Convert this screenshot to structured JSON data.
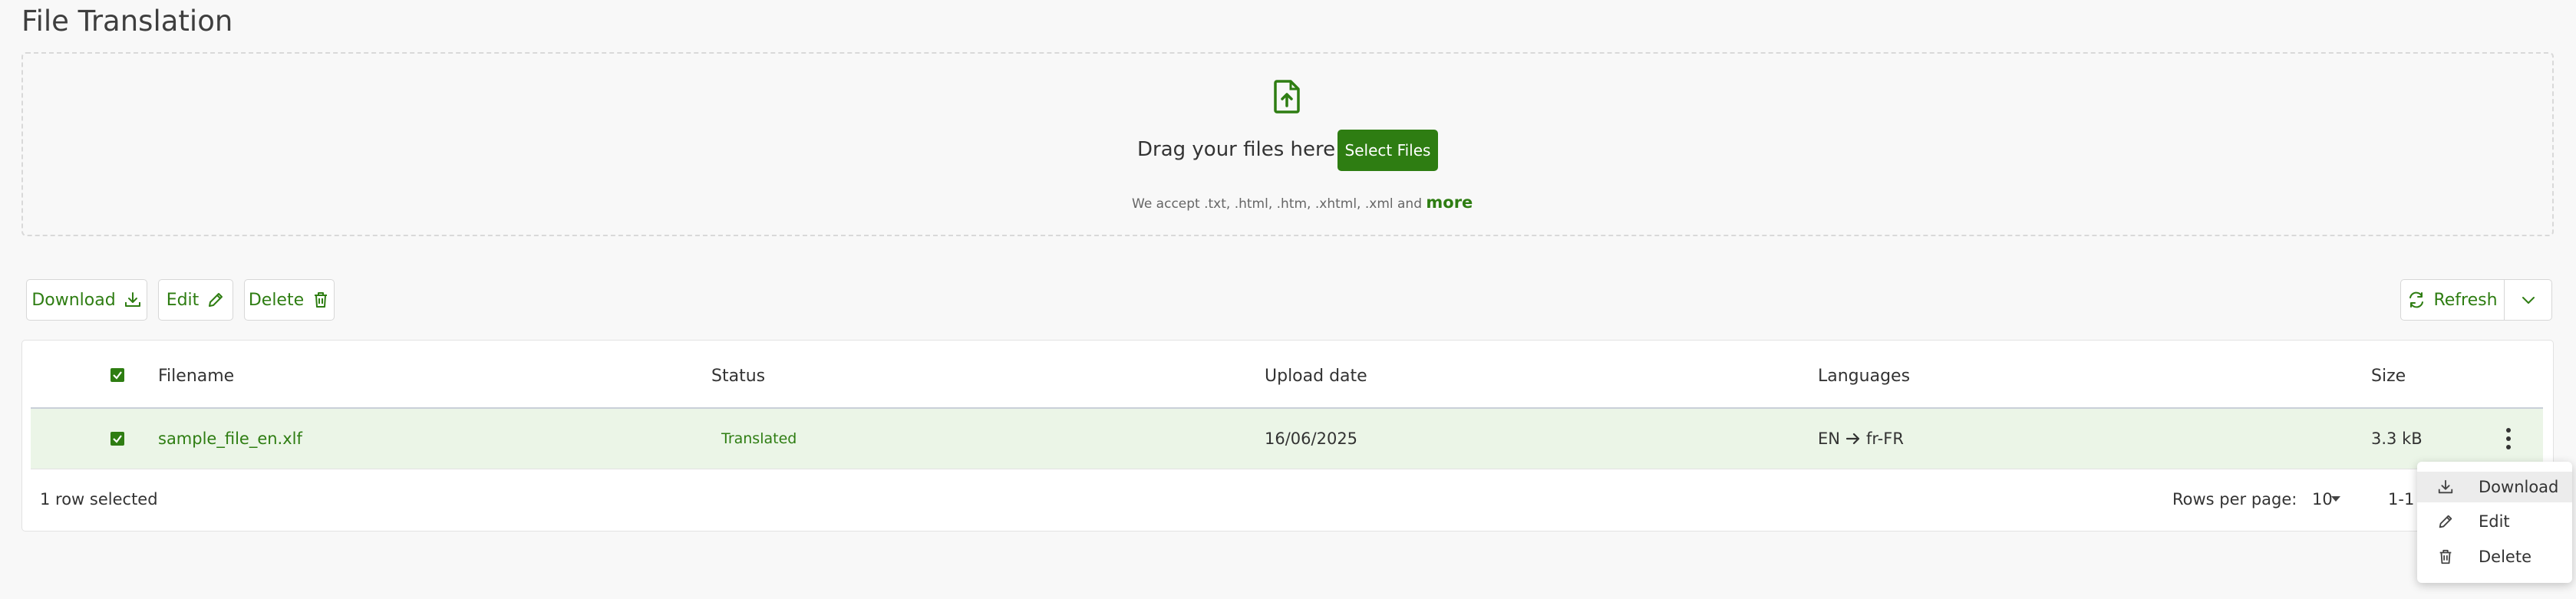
{
  "page_title": "File Translation",
  "upload": {
    "icon": "file-upload-icon",
    "drag_text": "Drag your files here or",
    "select_button": "Select Files",
    "accept_text": "We accept .txt, .html, .htm, .xhtml, .xml and",
    "more_link": "more"
  },
  "toolbar": {
    "download_label": "Download",
    "edit_label": "Edit",
    "delete_label": "Delete",
    "refresh_label": "Refresh"
  },
  "table": {
    "columns": [
      "Filename",
      "Status",
      "Upload date",
      "Languages",
      "Size"
    ],
    "rows": [
      {
        "selected": true,
        "filename": "sample_file_en.xlf",
        "status": "Translated",
        "upload_date": "16/06/2025",
        "source_lang": "EN",
        "target_lang": "fr-FR",
        "size": "3.3 kB"
      }
    ],
    "footer": {
      "selection_text": "1 row selected",
      "rows_per_page_label": "Rows per page:",
      "rows_per_page_value": "10",
      "range_text": "1-1 o"
    }
  },
  "row_menu": {
    "items": [
      {
        "label": "Download",
        "icon": "download-icon"
      },
      {
        "label": "Edit",
        "icon": "pencil-icon"
      },
      {
        "label": "Delete",
        "icon": "trash-icon"
      }
    ]
  },
  "colors": {
    "accent": "#2e7d12",
    "selected_row": "#ebf5e7"
  }
}
